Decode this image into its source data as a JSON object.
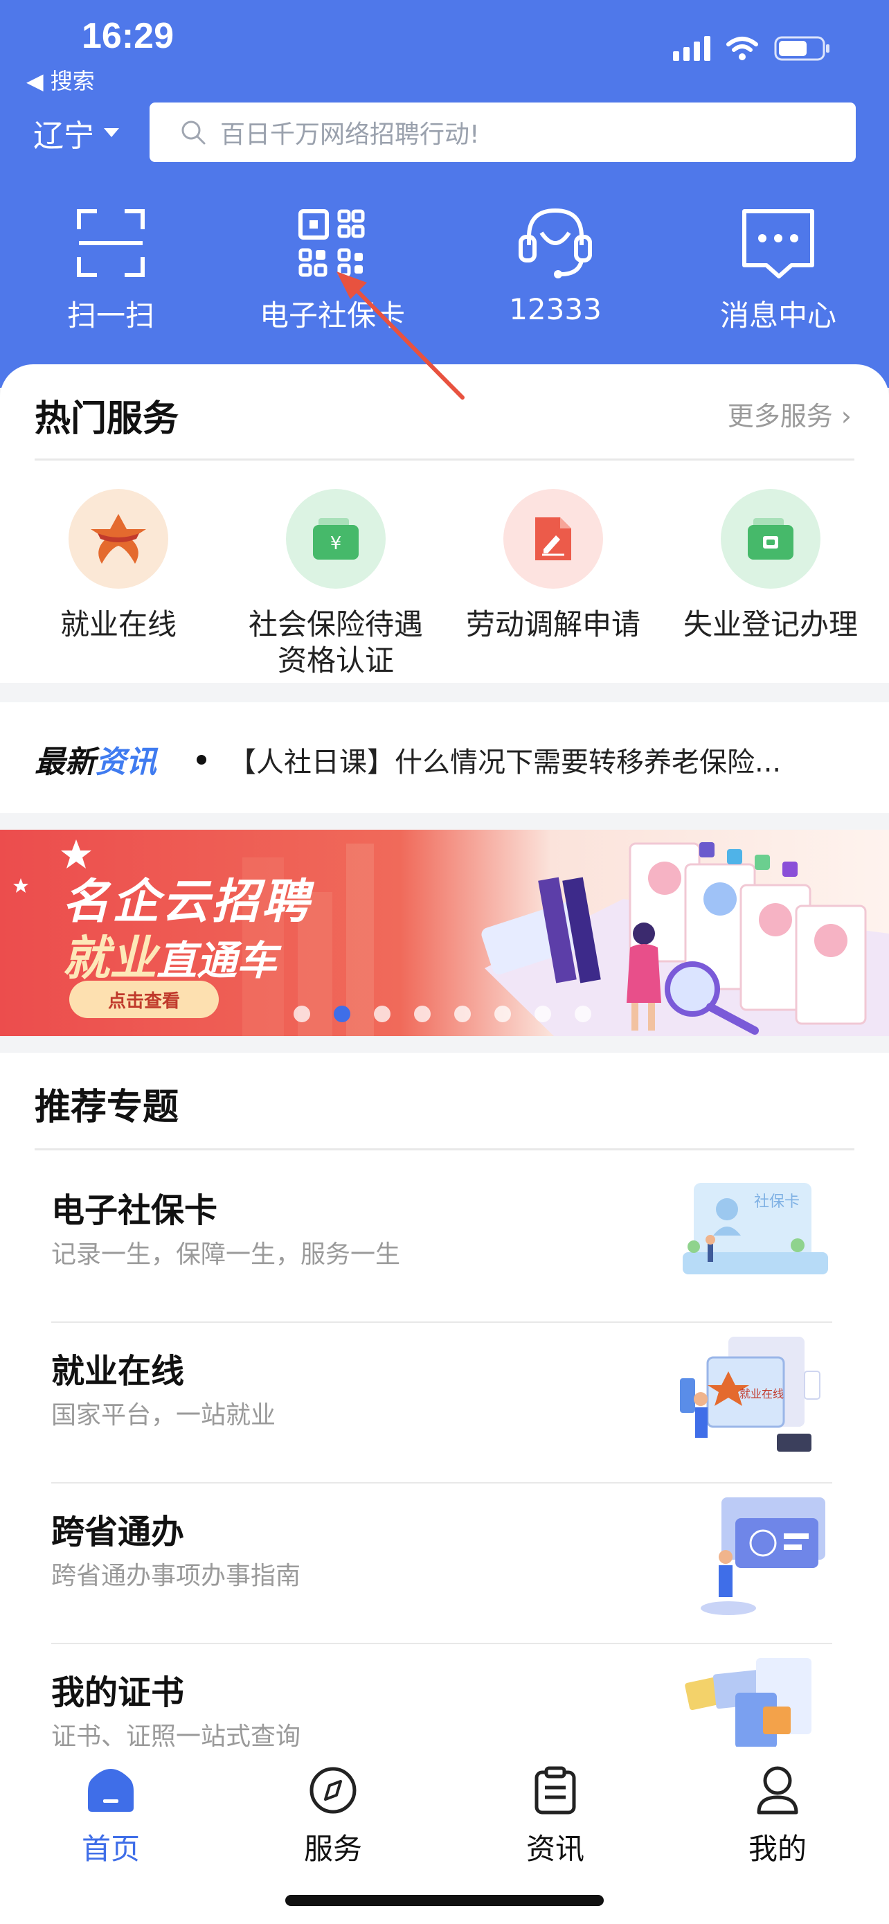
{
  "status_bar": {
    "time": "16:29",
    "back_label": "◀ 搜索"
  },
  "header": {
    "region": "辽宁",
    "search_placeholder": "百日千万网络招聘行动!",
    "quick_actions": [
      {
        "label": "扫一扫",
        "icon": "scan-icon"
      },
      {
        "label": "电子社保卡",
        "icon": "qr-code-icon"
      },
      {
        "label": "12333",
        "icon": "headset-icon"
      },
      {
        "label": "消息中心",
        "icon": "message-icon"
      }
    ]
  },
  "hot_services": {
    "title": "热门服务",
    "more": "更多服务 ›",
    "items": [
      {
        "label": "就业在线",
        "icon": "employment-logo-icon",
        "color": "#fbe8d6"
      },
      {
        "label": "社会保险待遇资格认证",
        "line1": "社会保险待遇",
        "line2": "资格认证",
        "icon": "wallet-yuan-icon",
        "color": "#dcf3e3"
      },
      {
        "label": "劳动调解申请",
        "icon": "document-edit-icon",
        "color": "#fde3e0"
      },
      {
        "label": "失业登记办理",
        "icon": "wallet-icon",
        "color": "#dcf3e3"
      }
    ]
  },
  "news": {
    "brand_a": "最新",
    "brand_b": "资讯",
    "headline": "【人社日课】什么情况下需要转移养老保险..."
  },
  "banner": {
    "line1": "名企云招聘",
    "line2a": "就业",
    "line2b": "直通车",
    "button": "点击查看",
    "page_count": 8,
    "active_page": 2
  },
  "recommended": {
    "title": "推荐专题",
    "items": [
      {
        "title": "电子社保卡",
        "subtitle": "记录一生，保障一生，服务一生",
        "image_caption": "社保卡"
      },
      {
        "title": "就业在线",
        "subtitle": "国家平台，一站就业",
        "image_caption": "就业在线"
      },
      {
        "title": "跨省通办",
        "subtitle": "跨省通办事项办事指南"
      },
      {
        "title": "我的证书",
        "subtitle": "证书、证照一站式查询"
      }
    ]
  },
  "tabbar": {
    "tabs": [
      {
        "label": "首页",
        "icon": "home-icon",
        "active": true
      },
      {
        "label": "服务",
        "icon": "compass-icon",
        "active": false
      },
      {
        "label": "资讯",
        "icon": "clipboard-icon",
        "active": false
      },
      {
        "label": "我的",
        "icon": "user-icon",
        "active": false
      }
    ]
  },
  "colors": {
    "brand": "#4f78ea",
    "accent": "#3f6ee8",
    "arrow": "#e8523f"
  }
}
